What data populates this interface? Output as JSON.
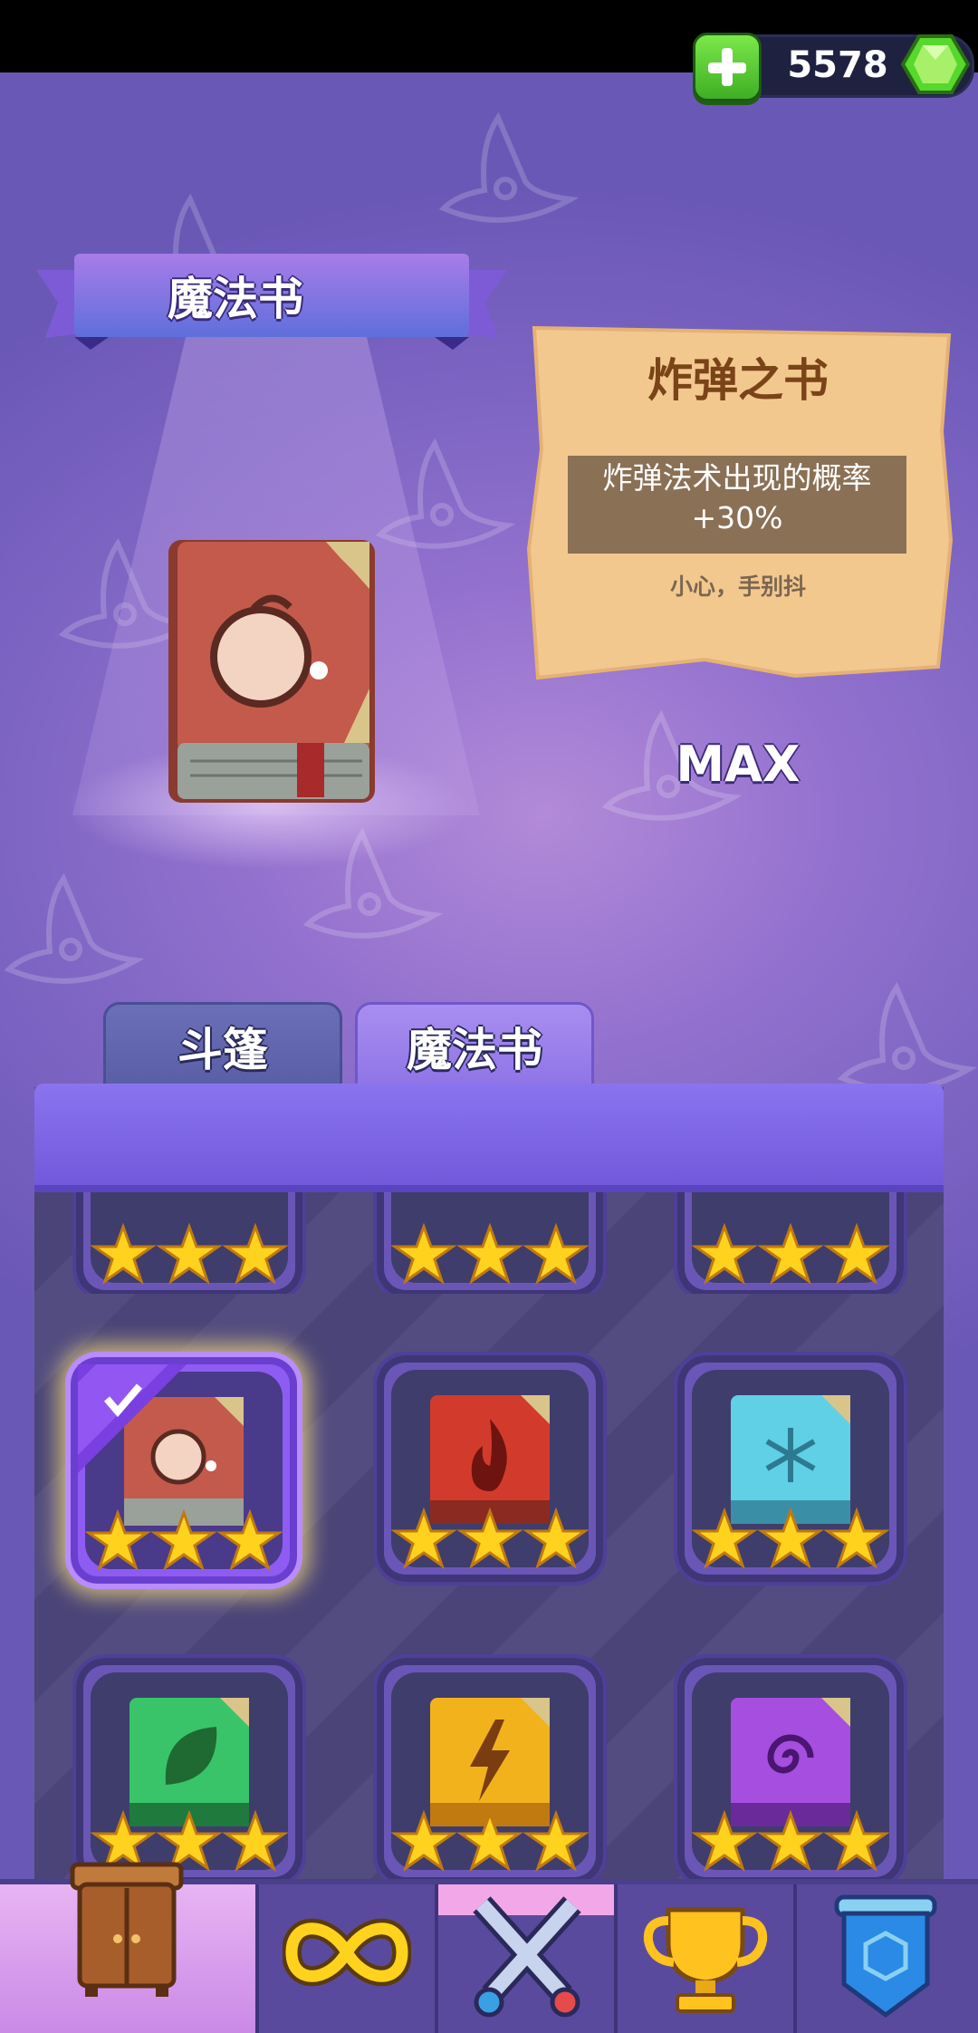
{
  "currency": {
    "gems": "5578",
    "add_icon": "plus-icon",
    "gem_icon": "green-gem-icon"
  },
  "banner": {
    "title": "魔法书"
  },
  "selected_book": {
    "name": "炸弹之书",
    "description": "炸弹法术出现的概率+30%",
    "note": "小心，手别抖",
    "level": "MAX",
    "icon": "bomb-book-icon"
  },
  "tabs": [
    {
      "label": "斗篷",
      "active": false
    },
    {
      "label": "魔法书",
      "active": true
    }
  ],
  "books": [
    {
      "name": "bomb-book",
      "color": "#c45a4c",
      "icon": "bomb-icon",
      "stars": 3,
      "selected": true
    },
    {
      "name": "fire-book",
      "color": "#d23b2c",
      "icon": "flame-icon",
      "stars": 3,
      "selected": false
    },
    {
      "name": "ice-book",
      "color": "#5fd0e6",
      "icon": "snowflake-icon",
      "stars": 3,
      "selected": false
    },
    {
      "name": "leaf-book",
      "color": "#39c46a",
      "icon": "leaf-icon",
      "stars": 3,
      "selected": false
    },
    {
      "name": "lightning-book",
      "color": "#f2b21c",
      "icon": "lightning-icon",
      "stars": 3,
      "selected": false
    },
    {
      "name": "arcane-book",
      "color": "#a64ee0",
      "icon": "spiral-icon",
      "stars": 3,
      "selected": false
    }
  ],
  "partial_row_stars": [
    3,
    3,
    3
  ],
  "bottom_nav": [
    {
      "icon": "wardrobe-icon",
      "active": true
    },
    {
      "icon": "infinity-icon",
      "active": false
    },
    {
      "icon": "crossed-swords-icon",
      "active": false
    },
    {
      "icon": "trophy-icon",
      "active": false
    },
    {
      "icon": "shield-banner-icon",
      "active": false
    }
  ]
}
